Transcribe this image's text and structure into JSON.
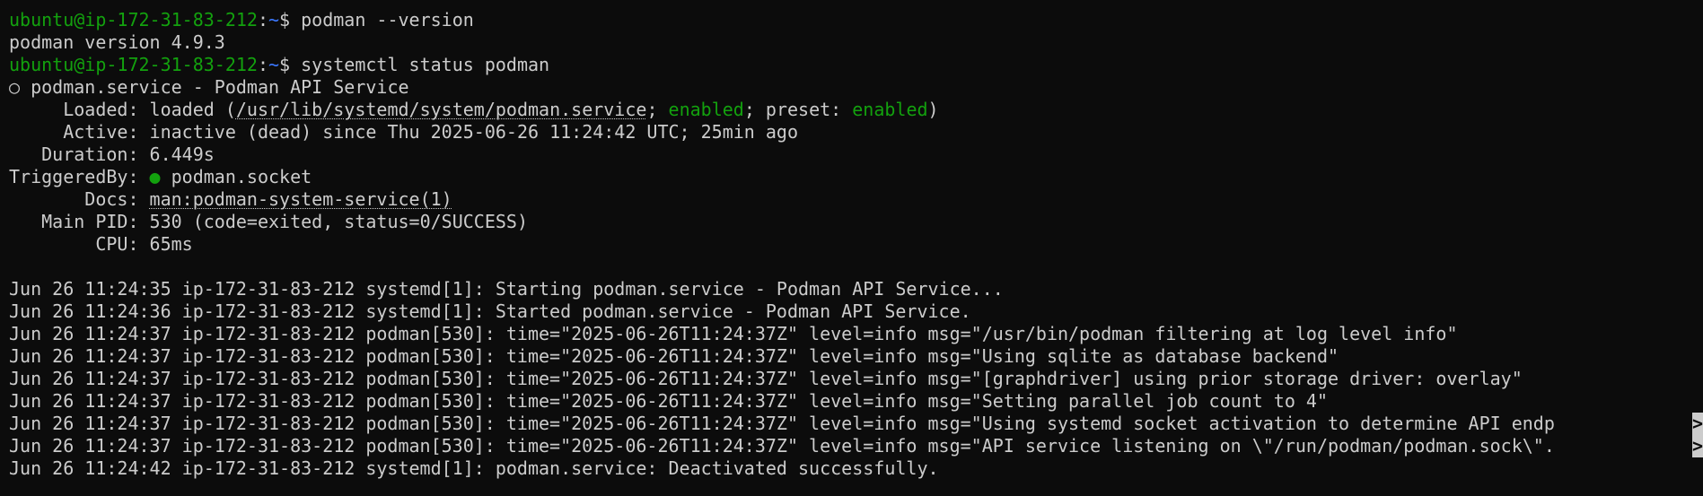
{
  "prompt": {
    "user_host": "ubuntu@ip-172-31-83-212",
    "sep": ":",
    "path": "~",
    "sigil": "$ "
  },
  "commands": [
    {
      "text": "podman --version"
    },
    {
      "text": "systemctl status podman"
    }
  ],
  "version_output": "podman version 4.9.3",
  "status": {
    "circle": "○",
    "title": " podman.service - Podman API Service",
    "loaded": {
      "label": "     Loaded: ",
      "pre": "loaded (",
      "path": "/usr/lib/systemd/system/podman.service",
      "mid1": "; ",
      "enabled1": "enabled",
      "mid2": "; preset: ",
      "enabled2": "enabled",
      "post": ")"
    },
    "active": {
      "label": "     Active: ",
      "value": "inactive (dead) since Thu 2025-06-26 11:24:42 UTC; 25min ago"
    },
    "duration": {
      "label": "   Duration: ",
      "value": "6.449s"
    },
    "triggered": {
      "label": "TriggeredBy: ",
      "dot": "●",
      "value": " podman.socket"
    },
    "docs": {
      "label": "       Docs: ",
      "value": "man:podman-system-service(1)"
    },
    "mainpid": {
      "label": "   Main PID: ",
      "value": "530 (code=exited, status=0/SUCCESS)"
    },
    "cpu": {
      "label": "        CPU: ",
      "value": "65ms"
    }
  },
  "logs": [
    "Jun 26 11:24:35 ip-172-31-83-212 systemd[1]: Starting podman.service - Podman API Service...",
    "Jun 26 11:24:36 ip-172-31-83-212 systemd[1]: Started podman.service - Podman API Service.",
    "Jun 26 11:24:37 ip-172-31-83-212 podman[530]: time=\"2025-06-26T11:24:37Z\" level=info msg=\"/usr/bin/podman filtering at log level info\"",
    "Jun 26 11:24:37 ip-172-31-83-212 podman[530]: time=\"2025-06-26T11:24:37Z\" level=info msg=\"Using sqlite as database backend\"",
    "Jun 26 11:24:37 ip-172-31-83-212 podman[530]: time=\"2025-06-26T11:24:37Z\" level=info msg=\"[graphdriver] using prior storage driver: overlay\"",
    "Jun 26 11:24:37 ip-172-31-83-212 podman[530]: time=\"2025-06-26T11:24:37Z\" level=info msg=\"Setting parallel job count to 4\"",
    "Jun 26 11:24:37 ip-172-31-83-212 podman[530]: time=\"2025-06-26T11:24:37Z\" level=info msg=\"Using systemd socket activation to determine API endp",
    "Jun 26 11:24:37 ip-172-31-83-212 podman[530]: time=\"2025-06-26T11:24:37Z\" level=info msg=\"API service listening on \\\"/run/podman/podman.sock\\\".",
    "Jun 26 11:24:42 ip-172-31-83-212 systemd[1]: podman.service: Deactivated successfully."
  ],
  "truncation_marker": ">",
  "colors": {
    "background": "#0c0c0c",
    "foreground": "#cccccc",
    "prompt_green": "#13a10e",
    "path_blue": "#3b78ff",
    "enabled_green": "#13a10e"
  }
}
